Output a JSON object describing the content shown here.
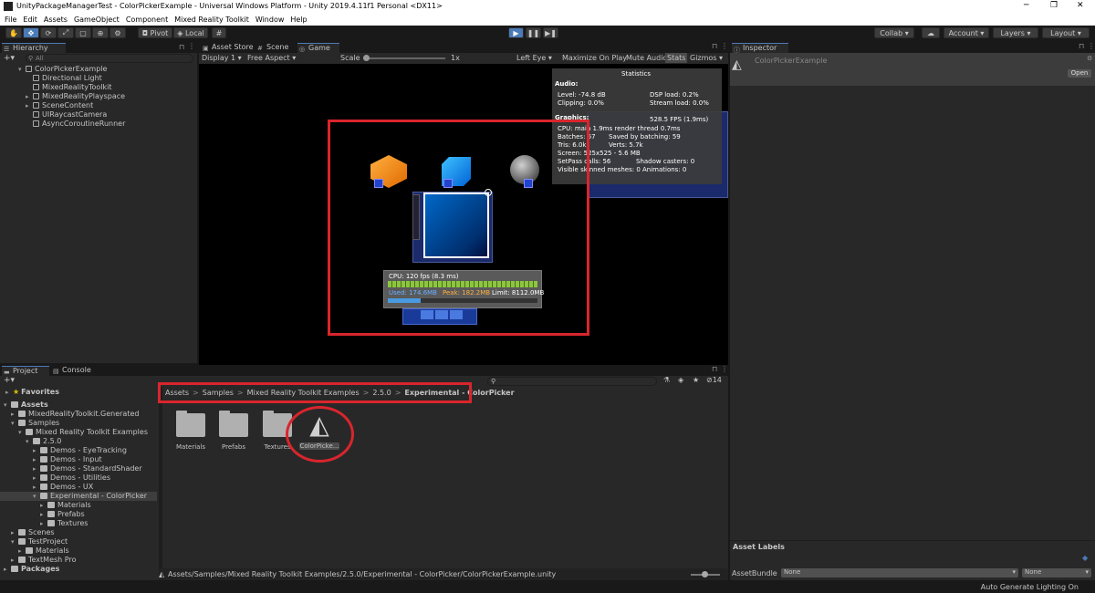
{
  "window": {
    "title": "UnityPackageManagerTest - ColorPickerExample - Universal Windows Platform - Unity 2019.4.11f1 Personal <DX11>",
    "minimize": "─",
    "maximize": "❐",
    "close": "✕"
  },
  "menu": [
    "File",
    "Edit",
    "Assets",
    "GameObject",
    "Component",
    "Mixed Reality Toolkit",
    "Window",
    "Help"
  ],
  "toolbar": {
    "pivot": "Pivot",
    "local": "Local",
    "collab": "Collab ▾",
    "account": "Account",
    "layers": "Layers",
    "layout": "Layout"
  },
  "hierarchy": {
    "tab": "Hierarchy",
    "search_placeholder": "All",
    "root": "ColorPickerExample",
    "items": [
      "Directional Light",
      "MixedRealityToolkit",
      "MixedRealityPlayspace",
      "SceneContent",
      "UIRaycastCamera",
      "AsyncCoroutineRunner"
    ]
  },
  "center_tabs": [
    "Asset Store",
    "Scene",
    "Game"
  ],
  "game_toolbar": {
    "display": "Display 1",
    "aspect": "Free Aspect",
    "scale_label": "Scale",
    "scale_value": "1x",
    "left_eye": "Left Eye",
    "maximize": "Maximize On Play",
    "mute": "Mute Audio",
    "stats": "Stats",
    "gizmos": "Gizmos"
  },
  "statistics": {
    "title": "Statistics",
    "audio_header": "Audio:",
    "level": "Level: -74.8 dB",
    "dsp": "DSP load: 0.2%",
    "clipping": "Clipping: 0.0%",
    "stream": "Stream load: 0.0%",
    "graphics_header": "Graphics:",
    "fps": "528.5 FPS (1.9ms)",
    "cpu": "CPU: main 1.9ms  render thread 0.7ms",
    "batches": "Batches: 67",
    "saved": "Saved by batching: 59",
    "tris": "Tris: 6.0k",
    "verts": "Verts: 5.7k",
    "screen": "Screen: 525x525 - 5.6 MB",
    "setpass": "SetPass calls: 56",
    "shadow": "Shadow casters: 0",
    "skinned": "Visible skinned meshes: 0",
    "anims": "Animations: 0"
  },
  "profiler": {
    "cpu": "CPU: 120 fps (8.3 ms)",
    "used": "Used: 174.6MB",
    "peak": "Peak: 182.2MB",
    "limit": "Limit: 8112.0MB"
  },
  "inspector": {
    "tab": "Inspector",
    "object": "ColorPickerExample",
    "open": "Open",
    "asset_labels": "Asset Labels",
    "asset_bundle": "AssetBundle",
    "bundle_value": "None",
    "variant_value": "None"
  },
  "project": {
    "tabs": [
      "Project",
      "Console"
    ],
    "favorites": "Favorites",
    "tree": [
      {
        "label": "Assets",
        "depth": 0,
        "bold": true,
        "open": true
      },
      {
        "label": "MixedRealityToolkit.Generated",
        "depth": 1
      },
      {
        "label": "Samples",
        "depth": 1,
        "open": true
      },
      {
        "label": "Mixed Reality Toolkit Examples",
        "depth": 2,
        "open": true
      },
      {
        "label": "2.5.0",
        "depth": 3,
        "open": true
      },
      {
        "label": "Demos - EyeTracking",
        "depth": 4
      },
      {
        "label": "Demos - Input",
        "depth": 4
      },
      {
        "label": "Demos - StandardShader",
        "depth": 4
      },
      {
        "label": "Demos - Utilities",
        "depth": 4
      },
      {
        "label": "Demos - UX",
        "depth": 4
      },
      {
        "label": "Experimental - ColorPicker",
        "depth": 4,
        "open": true,
        "selected": true
      },
      {
        "label": "Materials",
        "depth": 5
      },
      {
        "label": "Prefabs",
        "depth": 5
      },
      {
        "label": "Textures",
        "depth": 5
      },
      {
        "label": "Scenes",
        "depth": 1
      },
      {
        "label": "TestProject",
        "depth": 1,
        "open": true
      },
      {
        "label": "Materials",
        "depth": 2
      },
      {
        "label": "TextMesh Pro",
        "depth": 1
      },
      {
        "label": "Packages",
        "depth": 0,
        "bold": true
      }
    ],
    "breadcrumb": [
      "Assets",
      "Samples",
      "Mixed Reality Toolkit Examples",
      "2.5.0",
      "Experimental - ColorPicker"
    ],
    "assets": [
      "Materials",
      "Prefabs",
      "Textures",
      "ColorPicke..."
    ],
    "hidden_count": "14",
    "path": "Assets/Samples/Mixed Reality Toolkit Examples/2.5.0/Experimental - ColorPicker/ColorPickerExample.unity"
  },
  "status": "Auto Generate Lighting On",
  "colors": {
    "highlight_red": "#d9252d",
    "accent_blue": "#4a7bb7"
  }
}
